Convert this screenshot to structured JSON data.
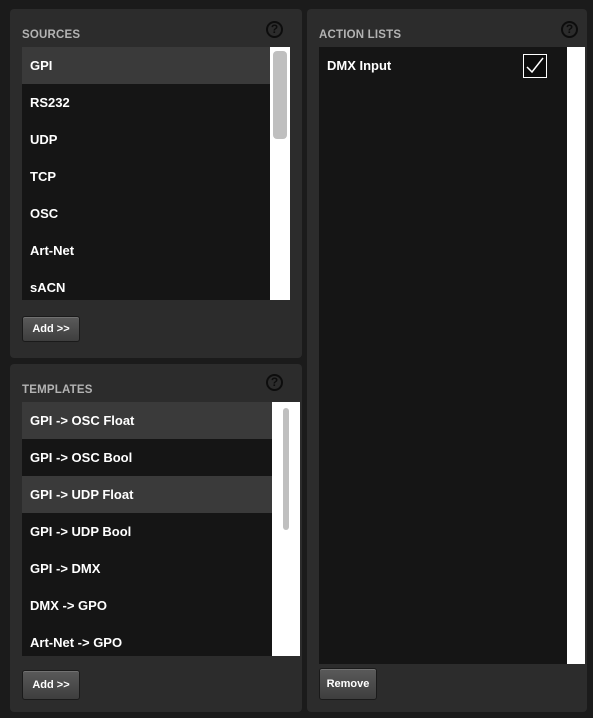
{
  "sources": {
    "title": "SOURCES",
    "help_glyph": "?",
    "items": [
      "GPI",
      "RS232",
      "UDP",
      "TCP",
      "OSC",
      "Art-Net",
      "sACN"
    ],
    "add_label": "Add >>"
  },
  "templates": {
    "title": "TEMPLATES",
    "help_glyph": "?",
    "items": [
      "GPI -> OSC Float",
      "GPI -> OSC Bool",
      "GPI -> UDP Float",
      "GPI -> UDP Bool",
      "GPI -> DMX",
      "DMX -> GPO",
      "Art-Net -> GPO"
    ],
    "add_label": "Add >>"
  },
  "action_lists": {
    "title": "ACTION LISTS",
    "help_glyph": "?",
    "items": [
      {
        "label": "DMX Input",
        "checked": true
      }
    ],
    "remove_label": "Remove"
  },
  "icons": {
    "help": "help-circle-icon",
    "check": "checkmark-icon"
  }
}
